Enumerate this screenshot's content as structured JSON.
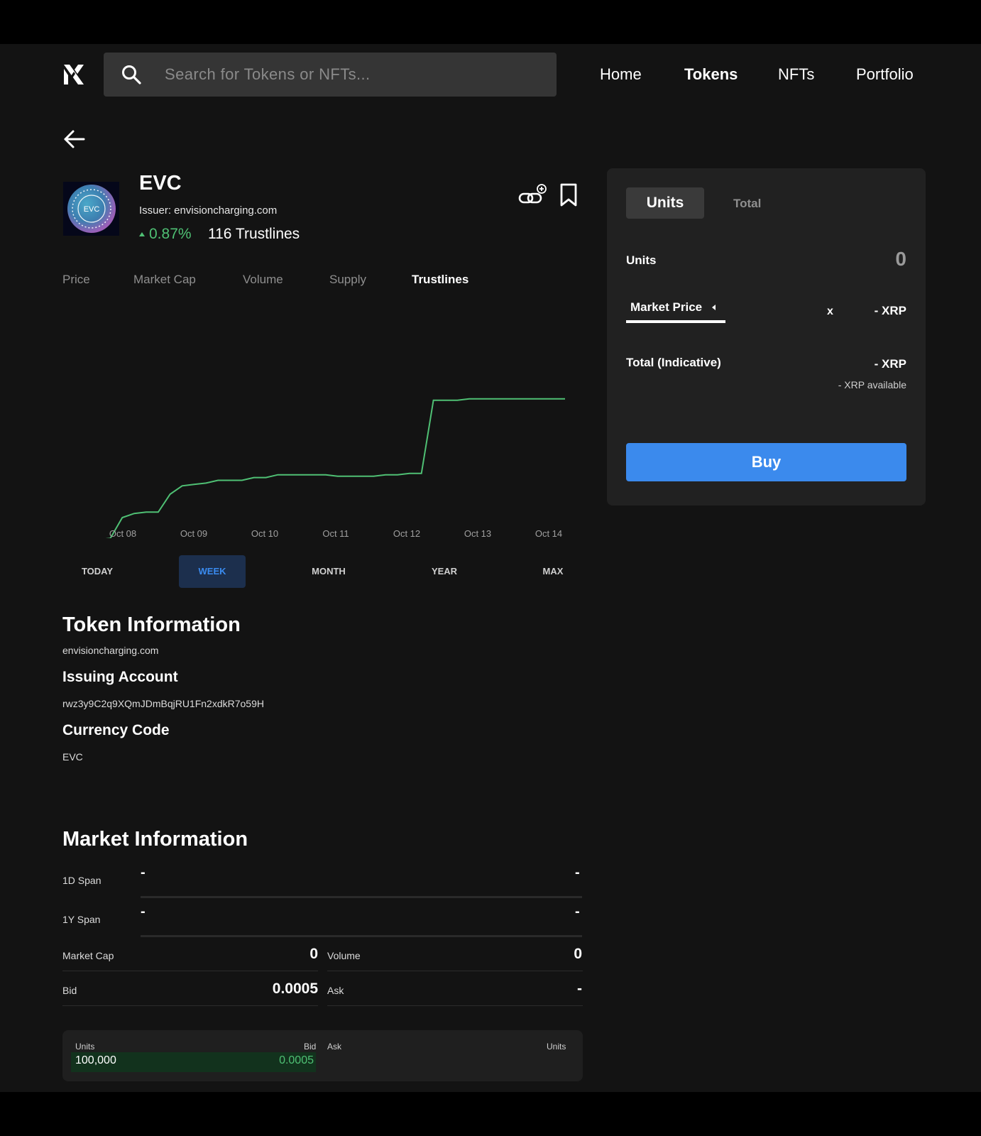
{
  "header": {
    "search_placeholder": "Search for Tokens or NFTs...",
    "nav": [
      "Home",
      "Tokens",
      "NFTs",
      "Portfolio"
    ],
    "active_nav": "Tokens"
  },
  "token": {
    "name": "EVC",
    "logo_text": "EVC",
    "issuer": "Issuer: envisioncharging.com",
    "change": "0.87%",
    "trustlines": "116 Trustlines"
  },
  "metric_tabs": [
    "Price",
    "Market Cap",
    "Volume",
    "Supply",
    "Trustlines"
  ],
  "active_metric": "Trustlines",
  "chart_data": {
    "type": "line",
    "x_ticks": [
      "Oct 08",
      "Oct 09",
      "Oct 10",
      "Oct 11",
      "Oct 12",
      "Oct 13",
      "Oct 14"
    ],
    "series": [
      {
        "color": "#4fc074",
        "values": [
          0,
          2,
          3,
          3,
          4,
          19,
          22,
          23,
          23,
          36,
          42,
          43,
          44,
          46,
          46,
          46,
          48,
          48,
          50,
          50,
          50,
          50,
          50,
          49,
          49,
          49,
          49,
          50,
          50,
          51,
          51,
          104,
          104,
          104,
          105,
          105,
          105,
          105,
          105,
          105,
          105,
          105,
          105
        ]
      }
    ],
    "baseline": 0,
    "ylim": [
      0,
      110
    ],
    "grid": false
  },
  "ranges": [
    "TODAY",
    "WEEK",
    "MONTH",
    "YEAR",
    "MAX"
  ],
  "active_range": "WEEK",
  "token_info": {
    "title": "Token Information",
    "domain": "envisioncharging.com",
    "issuing_label": "Issuing Account",
    "issuing_value": "rwz3y9C2q9XQmJDmBqjRU1Fn2xdkR7o59H",
    "currency_label": "Currency Code",
    "currency_value": "EVC"
  },
  "market_info": {
    "title": "Market Information",
    "span_1d": "1D Span",
    "span_1y": "1Y Span",
    "dash": "-",
    "market_cap_label": "Market Cap",
    "market_cap_value": "0",
    "volume_label": "Volume",
    "volume_value": "0",
    "bid_label": "Bid",
    "bid_value": "0.0005",
    "ask_label": "Ask",
    "ask_value": "-"
  },
  "order_book": {
    "units_header": "Units",
    "bid_header": "Bid",
    "ask_header": "Ask",
    "units_header_right": "Units",
    "bid_units": "100,000",
    "bid_price": "0.0005"
  },
  "order_panel": {
    "tab_units": "Units",
    "tab_total": "Total",
    "units_label": "Units",
    "units_value": "0",
    "market_price": "Market Price",
    "x": "x",
    "price_xrp": "- XRP",
    "total_label": "Total (Indicative)",
    "total_xrp": "- XRP",
    "available": "- XRP available",
    "buy": "Buy"
  },
  "colors": {
    "accent": "#3b8aed",
    "positive": "#4fc074",
    "background": "#131313",
    "panel": "#212121"
  }
}
